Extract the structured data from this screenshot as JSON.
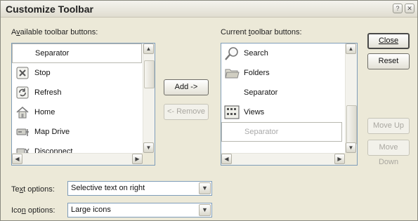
{
  "dialog": {
    "title": "Customize Toolbar",
    "help_glyph": "?",
    "close_glyph": "✕"
  },
  "available": {
    "label_pre": "A",
    "label_hot": "v",
    "label_post": "ailable toolbar buttons:",
    "items": [
      {
        "label": "Separator",
        "icon": "none"
      },
      {
        "label": "Stop",
        "icon": "stop-icon"
      },
      {
        "label": "Refresh",
        "icon": "refresh-icon"
      },
      {
        "label": "Home",
        "icon": "home-icon"
      },
      {
        "label": "Map Drive",
        "icon": "map-drive-icon"
      },
      {
        "label": "Disconnect",
        "icon": "disconnect-icon"
      }
    ]
  },
  "current": {
    "label_pre": "Current ",
    "label_hot": "t",
    "label_post": "oolbar buttons:",
    "items": [
      {
        "label": "Search",
        "icon": "search-icon"
      },
      {
        "label": "Folders",
        "icon": "folders-icon"
      },
      {
        "label": "Separator",
        "icon": "none"
      },
      {
        "label": "Views",
        "icon": "views-icon"
      },
      {
        "label": "Separator",
        "icon": "none"
      }
    ]
  },
  "buttons": {
    "add": "Add ->",
    "remove": "<- Remove",
    "close": "Close",
    "reset": "Reset",
    "move_up": "Move Up",
    "move_down": "Move Down"
  },
  "text_options": {
    "label_pre": "Te",
    "label_hot": "x",
    "label_post": "t options:",
    "value": "Selective text on right"
  },
  "icon_options": {
    "label_pre": "Ico",
    "label_hot": "n",
    "label_post": " options:",
    "value": "Large icons"
  }
}
